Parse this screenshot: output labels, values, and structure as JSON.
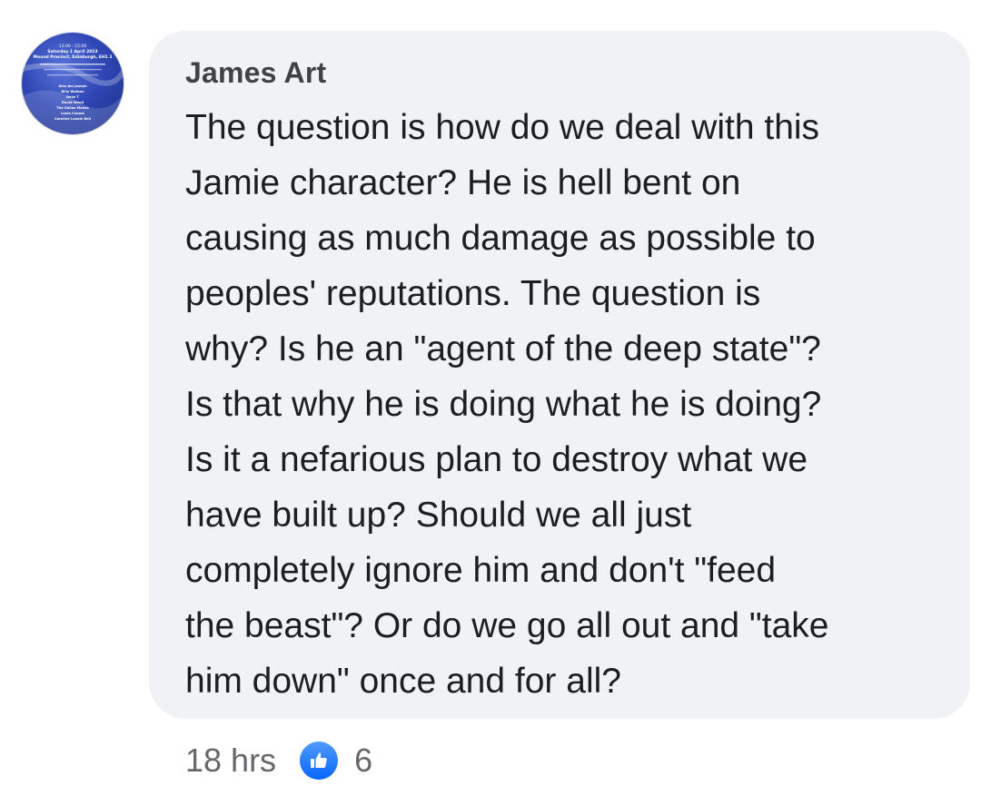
{
  "comment": {
    "author": "James Art",
    "lines": [
      "The question is how do we deal with this",
      "Jamie character? He is hell bent on",
      "causing as much damage as possible to",
      "peoples' reputations. The question is",
      "why? Is he an \"agent of the deep state\"?",
      "Is that why he is doing what he is doing?",
      "Is it a nefarious plan to destroy what we",
      "have built up? Should we all just",
      "completely ignore him and don't \"feed",
      "the beast\"? Or do we go all out and \"take",
      "him down\" once and for all?"
    ],
    "timestamp": "18 hrs",
    "reaction_icon": "thumbs-up-icon",
    "reaction_count": "6"
  },
  "avatar": {
    "poster_lines": [
      "13:00 - 15:00",
      "Saturday 1 April 2023",
      "Mound Precinct, Edinburgh, EH1 2",
      "Alan Jim Joseph",
      "Billy Watson",
      "Dave T",
      "David Wood",
      "The Gallus Monks",
      "Louis Clumm",
      "Caroline Lousie Bell"
    ]
  },
  "colors": {
    "bubble": "#f0f2f5",
    "author": "#3f4247",
    "text": "#1c1e21",
    "meta": "#65676b",
    "like": "#0866ff"
  }
}
